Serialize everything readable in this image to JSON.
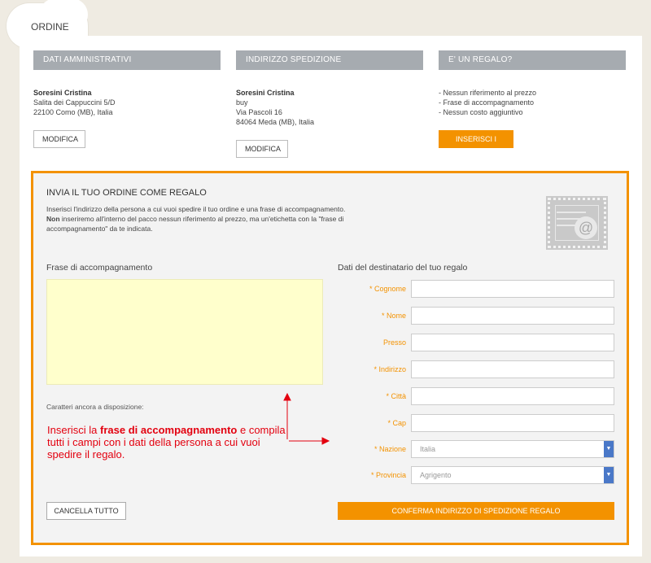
{
  "header": {
    "tab_label": "ORDINE"
  },
  "columns": [
    {
      "heading": "DATI AMMINISTRATIVI",
      "name": "Soresini Cristina",
      "lines": [
        "Salita dei Cappuccini 5/D",
        "22100 Como (MB), Italia"
      ],
      "button": "MODIFICA"
    },
    {
      "heading": "INDIRIZZO SPEDIZIONE",
      "name": "Soresini Cristina",
      "lines": [
        "buy",
        "Via Pascoli 16",
        "84064 Meda (MB), Italia"
      ],
      "button": "MODIFICA"
    },
    {
      "heading": "E' UN REGALO?",
      "lines": [
        "- Nessun riferimento al prezzo",
        "- Frase di accompagnamento",
        "- Nessun costo aggiuntivo"
      ],
      "button": "INSERISCI I DATI"
    }
  ],
  "gift": {
    "title": "INVIA IL TUO ORDINE COME REGALO",
    "desc_line1": "Inserisci l'indirizzo della persona a cui vuoi spedire il tuo ordine e una frase di accompagnamento.",
    "desc_bold": "Non",
    "desc_line2": " inseriremo all'interno del pacco nessun riferimento al prezzo, ma un'etichetta con la \"frase di accompagnamento\" da te indicata.",
    "stamp_symbol": "@",
    "message_label": "Frase di accompagnamento",
    "counter_label": "Caratteri ancora a disposizione:",
    "recipient_label": "Dati del destinatario del tuo regalo",
    "fields": {
      "cognome": "* Cognome",
      "nome": "* Nome",
      "presso": "Presso",
      "indirizzo": "* Indirizzo",
      "citta": "* Città",
      "cap": "* Cap",
      "nazione": "* Nazione",
      "provincia": "* Provincia"
    },
    "nazione_value": "Italia",
    "provincia_value": "Agrigento",
    "cancel_button": "CANCELLA TUTTO",
    "confirm_button": "CONFERMA INDIRIZZO DI SPEDIZIONE REGALO"
  },
  "annotation": {
    "part1": "Inserisci la ",
    "bold": "frase di accompagnamento",
    "part2": " e compila tutti i campi con i dati della persona a cui vuoi spedire il regalo."
  },
  "colors": {
    "accent": "#f39200",
    "annotation": "#e3000f",
    "header_bg": "#a6abb0",
    "message_bg": "#ffffcc"
  }
}
